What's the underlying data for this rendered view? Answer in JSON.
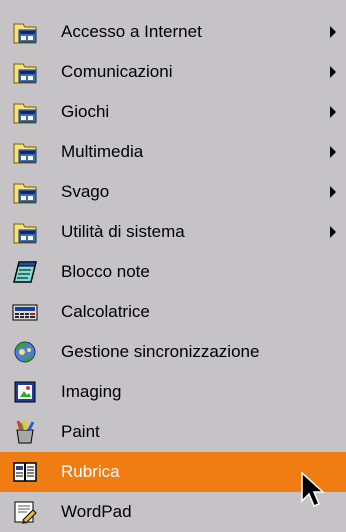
{
  "menu": {
    "items": [
      {
        "label": "Accesso a Internet",
        "icon": "program-folder-icon",
        "submenu": true
      },
      {
        "label": "Comunicazioni",
        "icon": "program-folder-icon",
        "submenu": true
      },
      {
        "label": "Giochi",
        "icon": "program-folder-icon",
        "submenu": true
      },
      {
        "label": "Multimedia",
        "icon": "program-folder-icon",
        "submenu": true
      },
      {
        "label": "Svago",
        "icon": "program-folder-icon",
        "submenu": true
      },
      {
        "label": "Utilità di sistema",
        "icon": "program-folder-icon",
        "submenu": true
      },
      {
        "label": "Blocco note",
        "icon": "notepad-icon",
        "submenu": false
      },
      {
        "label": "Calcolatrice",
        "icon": "calculator-icon",
        "submenu": false
      },
      {
        "label": "Gestione sincronizzazione",
        "icon": "synchronize-icon",
        "submenu": false
      },
      {
        "label": "Imaging",
        "icon": "imaging-icon",
        "submenu": false
      },
      {
        "label": "Paint",
        "icon": "paint-icon",
        "submenu": false
      },
      {
        "label": "Rubrica",
        "icon": "address-book-icon",
        "submenu": false,
        "highlighted": true
      },
      {
        "label": "WordPad",
        "icon": "wordpad-icon",
        "submenu": false
      }
    ]
  },
  "colors": {
    "menu_background": "#c6c3c6",
    "highlight": "#f07c14",
    "highlight_text": "#ffffff",
    "text": "#000000"
  }
}
